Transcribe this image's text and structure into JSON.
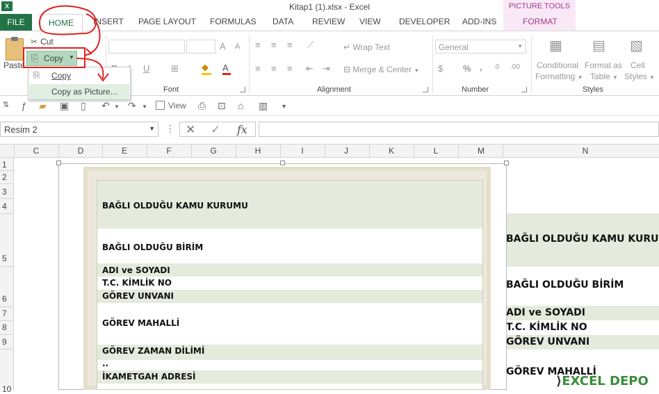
{
  "app": {
    "title": "Kitap1 (1).xlsx - Excel",
    "context_group": "PICTURE TOOLS",
    "logo": "X"
  },
  "tabs": [
    "FILE",
    "HOME",
    "INSERT",
    "PAGE LAYOUT",
    "FORMULAS",
    "DATA",
    "REVIEW",
    "VIEW",
    "DEVELOPER",
    "ADD-INS",
    "FORMAT"
  ],
  "ribbon": {
    "clipboard": {
      "paste": "Paste",
      "cut": "Cut",
      "copy": "Copy"
    },
    "font": {
      "label": "Font",
      "bold": "B",
      "italic": "I",
      "underline": "U",
      "grow": "A",
      "shrink": "A"
    },
    "alignment": {
      "label": "Alignment",
      "wrap_text": "Wrap Text",
      "merge_center": "Merge & Center"
    },
    "number": {
      "label": "Number",
      "format": "General",
      "percent": "%",
      "comma": ","
    },
    "styles": {
      "label": "Styles",
      "conditional": "Conditional",
      "formatting": "Formatting",
      "format_as": "Format as",
      "table": "Table",
      "cell": "Cell",
      "cell_styles": "Styles"
    }
  },
  "copy_menu": {
    "items": [
      "Copy",
      "Copy as Picture..."
    ]
  },
  "qat": {
    "view_label": "View"
  },
  "formula_bar": {
    "name_box": "Resim 2",
    "fx": "fx",
    "formula": ""
  },
  "columns": [
    "C",
    "D",
    "E",
    "F",
    "G",
    "H",
    "I",
    "J",
    "K",
    "L",
    "M",
    "N"
  ],
  "rows": [
    "1",
    "2",
    "3",
    "4",
    "5",
    "6",
    "7",
    "8",
    "9",
    "10"
  ],
  "picture_rows": [
    "BAĞLI OLDUĞU KAMU KURUMU",
    "BAĞLI OLDUĞU BİRİM",
    "ADI ve SOYADI",
    "T.C. KİMLİK NO",
    "GÖREV UNVANI",
    "GÖREV MAHALLİ",
    "GÖREV ZAMAN DİLİMİ",
    "..",
    "İKAMETGAH ADRESİ"
  ],
  "sheet_rows": [
    "BAĞLI OLDUĞU KAMU KURUMU",
    "BAĞLI OLDUĞU BİRİM",
    "ADI ve SOYADI",
    "T.C. KİMLİK NO",
    "GÖREV UNVANI",
    "GÖREV MAHALLİ"
  ],
  "watermark": "EXCEL DEPO",
  "colors": {
    "excel_green": "#217346",
    "copy_highlight": "#b4d8bf",
    "annotation_red": "#e02020",
    "row_band": "#e4ebdd"
  }
}
